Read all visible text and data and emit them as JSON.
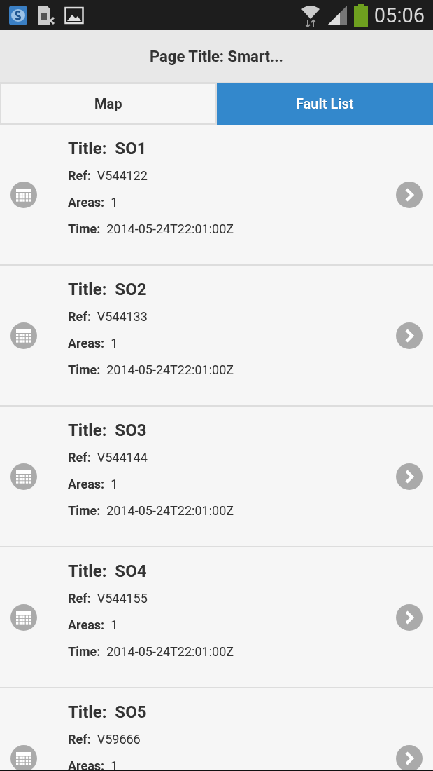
{
  "status_bar": {
    "time": "05:06"
  },
  "header": {
    "title": "Page Title: Smart..."
  },
  "tabs": [
    {
      "label": "Map",
      "selected": false
    },
    {
      "label": "Fault List",
      "selected": true
    }
  ],
  "items": [
    {
      "title_label": "Title:",
      "title": "SO1",
      "fields": [
        {
          "label": "Ref:",
          "value": "V544122"
        },
        {
          "label": "Areas:",
          "value": "1"
        },
        {
          "label": "Time:",
          "value": "2014-05-24T22:01:00Z"
        }
      ]
    },
    {
      "title_label": "Title:",
      "title": "SO2",
      "fields": [
        {
          "label": "Ref:",
          "value": "V544133"
        },
        {
          "label": "Areas:",
          "value": "1"
        },
        {
          "label": "Time:",
          "value": "2014-05-24T22:01:00Z"
        }
      ]
    },
    {
      "title_label": "Title:",
      "title": "SO3",
      "fields": [
        {
          "label": "Ref:",
          "value": "V544144"
        },
        {
          "label": "Areas:",
          "value": "1"
        },
        {
          "label": "Time:",
          "value": "2014-05-24T22:01:00Z"
        }
      ]
    },
    {
      "title_label": "Title:",
      "title": "SO4",
      "fields": [
        {
          "label": "Ref:",
          "value": "V544155"
        },
        {
          "label": "Areas:",
          "value": "1"
        },
        {
          "label": "Time:",
          "value": "2014-05-24T22:01:00Z"
        }
      ]
    },
    {
      "title_label": "Title:",
      "title": "SO5",
      "fields": [
        {
          "label": "Ref:",
          "value": "V59666"
        },
        {
          "label": "Areas:",
          "value": "1"
        }
      ]
    }
  ]
}
